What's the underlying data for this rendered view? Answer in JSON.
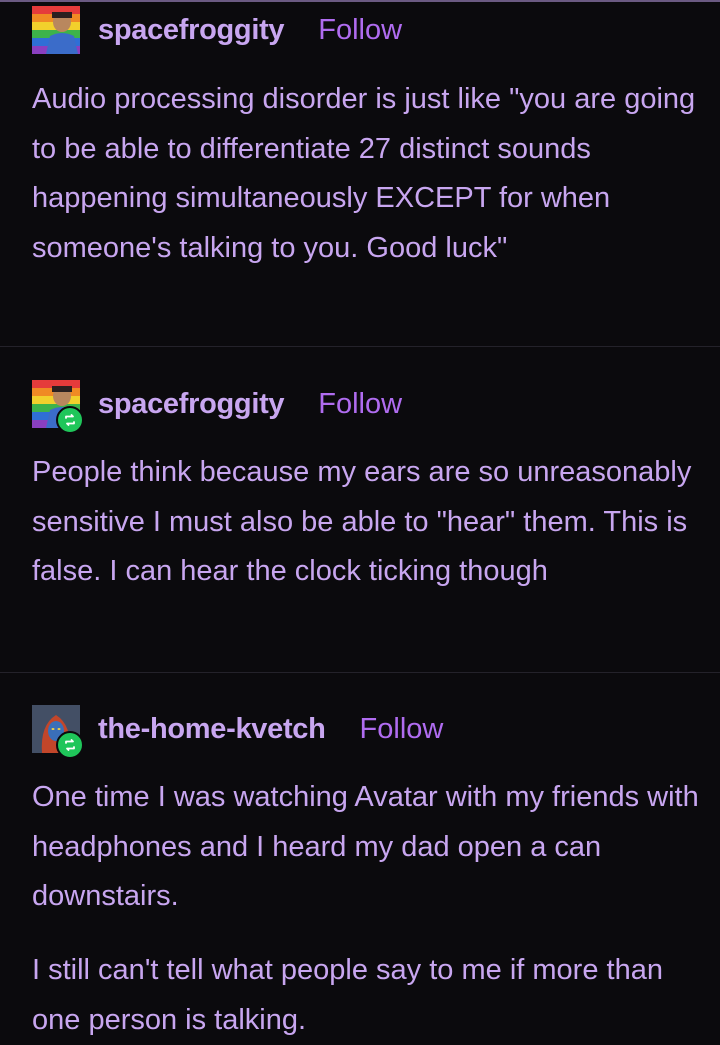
{
  "posts": [
    {
      "username": "spacefroggity",
      "follow_label": "Follow",
      "reblog": false,
      "paragraphs": [
        "Audio processing disorder is just like \"you are going to be able to differentiate 27 distinct sounds happening simultaneously EXCEPT for when someone's talking to you. Good luck\""
      ]
    },
    {
      "username": "spacefroggity",
      "follow_label": "Follow",
      "reblog": true,
      "paragraphs": [
        "People think because my ears are so unreasonably sensitive I must also be able to \"hear\" them. This is false. I can hear the clock ticking though"
      ]
    },
    {
      "username": "the-home-kvetch",
      "follow_label": "Follow",
      "reblog": true,
      "paragraphs": [
        "One time I was watching Avatar with my friends with headphones and I heard my dad open a can downstairs.",
        "I still can't tell what people say to me if more than one person is talking."
      ]
    }
  ],
  "icons": {
    "avatar_1": "pride-flag-avatar-icon",
    "avatar_2": "pride-flag-avatar-icon",
    "avatar_3": "character-avatar-icon",
    "reblog": "reblog-icon"
  },
  "colors": {
    "background": "#0b0a0d",
    "text": "#c8a6f0",
    "follow": "#b06cf0",
    "reblog_badge": "#1fc65a"
  }
}
